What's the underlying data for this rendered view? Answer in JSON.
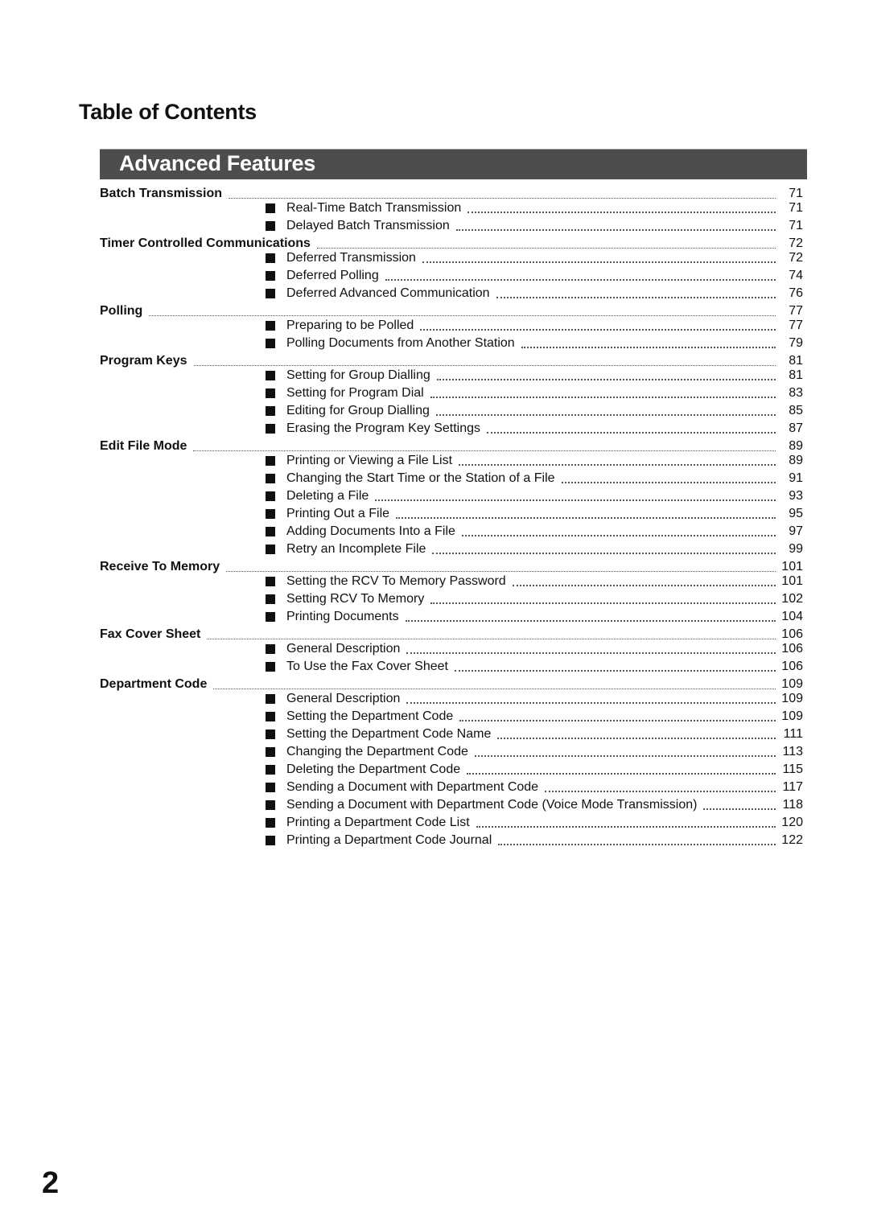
{
  "page": {
    "title": "Table of Contents",
    "section": "Advanced Features",
    "page_number": "2"
  },
  "toc": [
    {
      "title": "Batch Transmission",
      "page": "71",
      "items": [
        {
          "title": "Real-Time Batch Transmission",
          "page": "71"
        },
        {
          "title": "Delayed Batch Transmission",
          "page": "71"
        }
      ]
    },
    {
      "title": "Timer Controlled Communications",
      "page": "72",
      "items": [
        {
          "title": "Deferred Transmission",
          "page": "72"
        },
        {
          "title": "Deferred Polling",
          "page": "74"
        },
        {
          "title": "Deferred Advanced Communication",
          "page": "76"
        }
      ]
    },
    {
      "title": "Polling",
      "page": "77",
      "items": [
        {
          "title": "Preparing to be Polled",
          "page": "77"
        },
        {
          "title": "Polling Documents from Another Station",
          "page": "79"
        }
      ]
    },
    {
      "title": "Program Keys",
      "page": "81",
      "items": [
        {
          "title": "Setting for Group Dialling",
          "page": "81"
        },
        {
          "title": "Setting for Program Dial",
          "page": "83"
        },
        {
          "title": "Editing for Group Dialling",
          "page": "85"
        },
        {
          "title": "Erasing the Program Key Settings",
          "page": "87"
        }
      ]
    },
    {
      "title": "Edit File Mode",
      "page": "89",
      "items": [
        {
          "title": "Printing or Viewing a File List",
          "page": "89"
        },
        {
          "title": "Changing the Start Time or the Station of a File",
          "page": "91"
        },
        {
          "title": "Deleting a File",
          "page": "93"
        },
        {
          "title": "Printing Out a File",
          "page": "95"
        },
        {
          "title": "Adding Documents Into a File",
          "page": "97"
        },
        {
          "title": "Retry an Incomplete File",
          "page": "99"
        }
      ]
    },
    {
      "title": "Receive To Memory",
      "page": "101",
      "items": [
        {
          "title": "Setting the RCV To Memory Password",
          "page": "101"
        },
        {
          "title": "Setting RCV To Memory",
          "page": "102"
        },
        {
          "title": "Printing Documents",
          "page": "104"
        }
      ]
    },
    {
      "title": "Fax Cover Sheet",
      "page": "106",
      "items": [
        {
          "title": "General Description",
          "page": "106"
        },
        {
          "title": "To Use the Fax Cover Sheet",
          "page": "106"
        }
      ]
    },
    {
      "title": "Department Code",
      "page": "109",
      "items": [
        {
          "title": "General Description",
          "page": "109"
        },
        {
          "title": "Setting the Department Code",
          "page": "109"
        },
        {
          "title": "Setting the Department Code Name",
          "page": "111"
        },
        {
          "title": "Changing the Department Code",
          "page": "113"
        },
        {
          "title": "Deleting the Department Code",
          "page": "115"
        },
        {
          "title": "Sending a Document with Department Code",
          "page": "117"
        },
        {
          "title": "Sending a Document with Department Code (Voice Mode Transmission)",
          "page": "118"
        },
        {
          "title": "Printing a Department Code List",
          "page": "120"
        },
        {
          "title": "Printing a Department Code Journal",
          "page": "122"
        }
      ]
    }
  ]
}
